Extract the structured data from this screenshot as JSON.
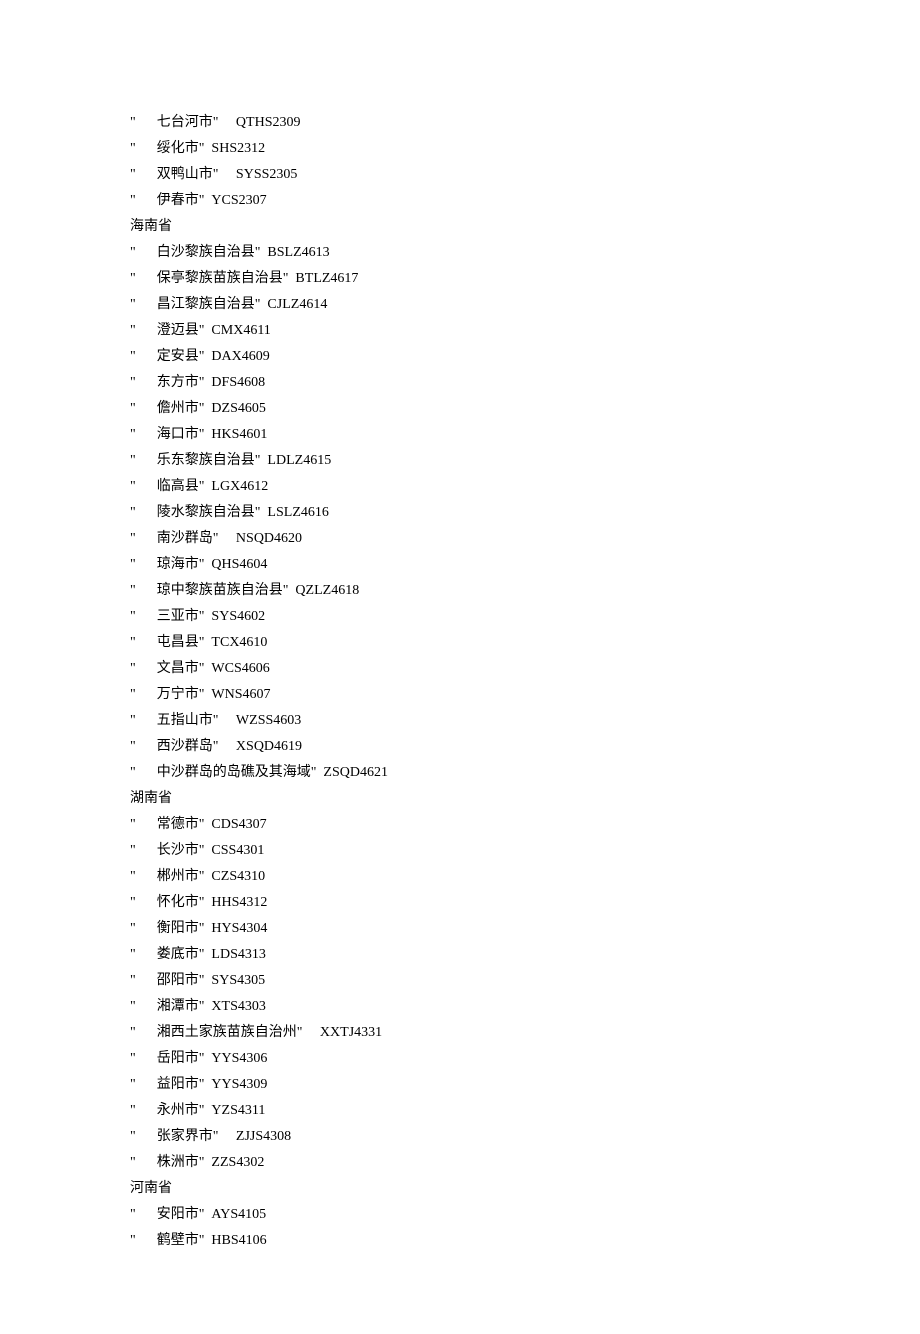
{
  "groups": [
    {
      "province": null,
      "entries": [
        {
          "name": "七台河市",
          "code": "QTHS2309",
          "wide_gap": true
        },
        {
          "name": "绥化市",
          "code": "SHS2312"
        },
        {
          "name": "双鸭山市",
          "code": "SYSS2305",
          "wide_gap": true
        },
        {
          "name": "伊春市",
          "code": "YCS2307"
        }
      ]
    },
    {
      "province": "海南省",
      "entries": [
        {
          "name": "白沙黎族自治县",
          "code": "BSLZ4613"
        },
        {
          "name": "保亭黎族苗族自治县",
          "code": "BTLZ4617"
        },
        {
          "name": "昌江黎族自治县",
          "code": "CJLZ4614"
        },
        {
          "name": "澄迈县",
          "code": "CMX4611"
        },
        {
          "name": "定安县",
          "code": "DAX4609"
        },
        {
          "name": "东方市",
          "code": "DFS4608"
        },
        {
          "name": "儋州市",
          "code": "DZS4605"
        },
        {
          "name": "海口市",
          "code": "HKS4601"
        },
        {
          "name": "乐东黎族自治县",
          "code": "LDLZ4615"
        },
        {
          "name": "临高县",
          "code": "LGX4612"
        },
        {
          "name": "陵水黎族自治县",
          "code": "LSLZ4616"
        },
        {
          "name": "南沙群岛",
          "code": "NSQD4620",
          "wide_gap": true
        },
        {
          "name": "琼海市",
          "code": "QHS4604"
        },
        {
          "name": "琼中黎族苗族自治县",
          "code": "QZLZ4618"
        },
        {
          "name": "三亚市",
          "code": "SYS4602"
        },
        {
          "name": "屯昌县",
          "code": "TCX4610"
        },
        {
          "name": "文昌市",
          "code": "WCS4606"
        },
        {
          "name": "万宁市",
          "code": "WNS4607"
        },
        {
          "name": "五指山市",
          "code": "WZSS4603",
          "wide_gap": true
        },
        {
          "name": "西沙群岛",
          "code": "XSQD4619",
          "wide_gap": true
        },
        {
          "name": "中沙群岛的岛礁及其海域",
          "code": "ZSQD4621"
        }
      ]
    },
    {
      "province": "湖南省",
      "entries": [
        {
          "name": "常德市",
          "code": "CDS4307"
        },
        {
          "name": "长沙市",
          "code": "CSS4301"
        },
        {
          "name": "郴州市",
          "code": "CZS4310"
        },
        {
          "name": "怀化市",
          "code": "HHS4312"
        },
        {
          "name": "衡阳市",
          "code": "HYS4304"
        },
        {
          "name": "娄底市",
          "code": "LDS4313"
        },
        {
          "name": "邵阳市",
          "code": "SYS4305"
        },
        {
          "name": "湘潭市",
          "code": "XTS4303"
        },
        {
          "name": "湘西土家族苗族自治州",
          "code": "XXTJ4331",
          "wide_gap": true
        },
        {
          "name": "岳阳市",
          "code": "YYS4306"
        },
        {
          "name": "益阳市",
          "code": "YYS4309"
        },
        {
          "name": "永州市",
          "code": "YZS4311"
        },
        {
          "name": "张家界市",
          "code": "ZJJS4308",
          "wide_gap": true
        },
        {
          "name": "株洲市",
          "code": "ZZS4302"
        }
      ]
    },
    {
      "province": "河南省",
      "entries": [
        {
          "name": "安阳市",
          "code": "AYS4105"
        },
        {
          "name": "鹤壁市",
          "code": "HBS4106"
        }
      ]
    }
  ]
}
